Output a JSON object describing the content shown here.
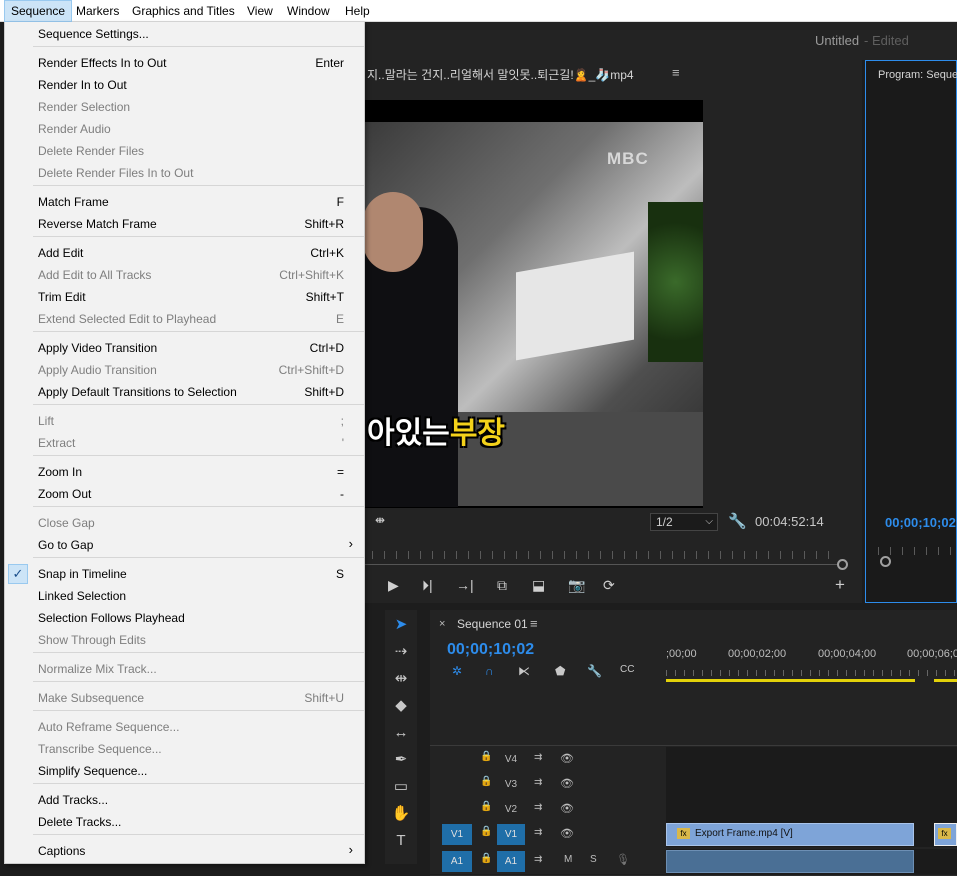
{
  "menubar": [
    "Sequence",
    "Markers",
    "Graphics and Titles",
    "View",
    "Window",
    "Help"
  ],
  "app": {
    "title": "Untitled",
    "title_suffix": "- Edited"
  },
  "source": {
    "title": "지..말라는 건지..리얼해서 말잇못..퇴근길!🙎_🧦mp4",
    "menu": "≡",
    "logo": "MBC",
    "subtitle_white": "아있는",
    "subtitle_yellow": "부장",
    "zoom": "1/2",
    "timecode": "00:04:52:14"
  },
  "program": {
    "title": "Program: Seque",
    "timecode": "00;00;10;02"
  },
  "timeline": {
    "tab": "Sequence 01",
    "timecode": "00;00;10;02",
    "ticks": [
      ";00;00",
      "00;00;02;00",
      "00;00;04;00",
      "00;00;06;0"
    ],
    "tracks": [
      {
        "name": "V4",
        "src": ""
      },
      {
        "name": "V3",
        "src": ""
      },
      {
        "name": "V2",
        "src": ""
      },
      {
        "name": "V1",
        "src": "V1"
      },
      {
        "name": "A1",
        "src": "A1"
      }
    ],
    "clip_label": "Export Frame.mp4 [V]",
    "fx": "fx",
    "mute": "M",
    "solo": "S"
  },
  "menu": {
    "items": [
      {
        "label": "Sequence Settings...",
        "shortcut": "",
        "disabled": false
      },
      {
        "label": "Render Effects In to Out",
        "shortcut": "Enter",
        "disabled": false
      },
      {
        "label": "Render In to Out",
        "shortcut": "",
        "disabled": false
      },
      {
        "label": "Render Selection",
        "shortcut": "",
        "disabled": true
      },
      {
        "label": "Render Audio",
        "shortcut": "",
        "disabled": true
      },
      {
        "label": "Delete Render Files",
        "shortcut": "",
        "disabled": true
      },
      {
        "label": "Delete Render Files In to Out",
        "shortcut": "",
        "disabled": true
      },
      {
        "label": "Match Frame",
        "shortcut": "F",
        "disabled": false
      },
      {
        "label": "Reverse Match Frame",
        "shortcut": "Shift+R",
        "disabled": false
      },
      {
        "label": "Add Edit",
        "shortcut": "Ctrl+K",
        "disabled": false
      },
      {
        "label": "Add Edit to All Tracks",
        "shortcut": "Ctrl+Shift+K",
        "disabled": true
      },
      {
        "label": "Trim Edit",
        "shortcut": "Shift+T",
        "disabled": false
      },
      {
        "label": "Extend Selected Edit to Playhead",
        "shortcut": "E",
        "disabled": true
      },
      {
        "label": "Apply Video Transition",
        "shortcut": "Ctrl+D",
        "disabled": false
      },
      {
        "label": "Apply Audio Transition",
        "shortcut": "Ctrl+Shift+D",
        "disabled": true
      },
      {
        "label": "Apply Default Transitions to Selection",
        "shortcut": "Shift+D",
        "disabled": false
      },
      {
        "label": "Lift",
        "shortcut": ";",
        "disabled": true
      },
      {
        "label": "Extract",
        "shortcut": "'",
        "disabled": true
      },
      {
        "label": "Zoom In",
        "shortcut": "=",
        "disabled": false
      },
      {
        "label": "Zoom Out",
        "shortcut": "-",
        "disabled": false
      },
      {
        "label": "Close Gap",
        "shortcut": "",
        "disabled": true
      },
      {
        "label": "Go to Gap",
        "shortcut": "",
        "disabled": false,
        "submenu": true
      },
      {
        "label": "Snap in Timeline",
        "shortcut": "S",
        "disabled": false,
        "checked": true
      },
      {
        "label": "Linked Selection",
        "shortcut": "",
        "disabled": false
      },
      {
        "label": "Selection Follows Playhead",
        "shortcut": "",
        "disabled": false
      },
      {
        "label": "Show Through Edits",
        "shortcut": "",
        "disabled": true
      },
      {
        "label": "Normalize Mix Track...",
        "shortcut": "",
        "disabled": true
      },
      {
        "label": "Make Subsequence",
        "shortcut": "Shift+U",
        "disabled": true
      },
      {
        "label": "Auto Reframe Sequence...",
        "shortcut": "",
        "disabled": true
      },
      {
        "label": "Transcribe Sequence...",
        "shortcut": "",
        "disabled": true
      },
      {
        "label": "Simplify Sequence...",
        "shortcut": "",
        "disabled": false
      },
      {
        "label": "Add Tracks...",
        "shortcut": "",
        "disabled": false
      },
      {
        "label": "Delete Tracks...",
        "shortcut": "",
        "disabled": false
      },
      {
        "label": "Captions",
        "shortcut": "",
        "disabled": false,
        "submenu": true
      }
    ]
  }
}
